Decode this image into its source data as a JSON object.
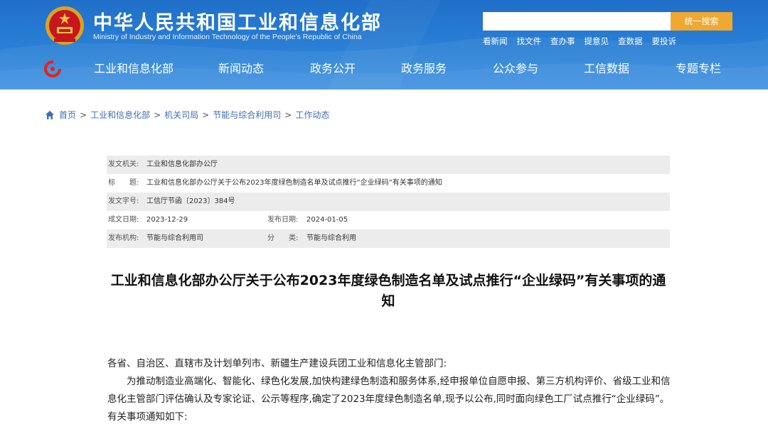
{
  "header": {
    "title": "中华人民共和国工业和信息化部",
    "subtitle": "Ministry of Industry and Information Technology of the People's Republic of China",
    "search_placeholder": "",
    "search_button": "统一搜索",
    "quick_links": [
      "看新闻",
      "找文件",
      "查办事",
      "提意见",
      "查数据",
      "要投诉"
    ],
    "colors": {
      "header_blue": "#2b80d6",
      "search_button": "#f0a830",
      "link_blue": "#3b6fb6"
    }
  },
  "nav": {
    "items": [
      "工业和信息化部",
      "新闻动态",
      "政务公开",
      "政务服务",
      "公众参与",
      "工信数据",
      "专题专栏"
    ]
  },
  "breadcrumb": {
    "items": [
      "首页",
      "工业和信息化部",
      "机关司局",
      "节能与综合利用司",
      "工作动态"
    ],
    "separator": ">"
  },
  "meta": {
    "issuer_label": "发文机关:",
    "issuer": "工业和信息化部办公厅",
    "title_label": "标　　题:",
    "title": "工业和信息化部办公厅关于公布2023年度绿色制造名单及试点推行“企业绿码”有关事项的通知",
    "doc_no_label": "发文字号:",
    "doc_no": "工信厅节函〔2023〕384号",
    "created_label": "成文日期:",
    "created": "2023-12-29",
    "published_label": "发布日期:",
    "published": "2024-01-05",
    "org_label": "发布机构:",
    "org": "节能与综合利用司",
    "category_label": "分　　类:",
    "category": "节能与综合利用"
  },
  "document": {
    "title": "工业和信息化部办公厅关于公布2023年度绿色制造名单及试点推行“企业绿码”有关事项的通知",
    "salutation": "各省、自治区、直辖市及计划单列市、新疆生产建设兵团工业和信息化主管部门:",
    "paragraph1": "为推动制造业高端化、智能化、绿色化发展,加快构建绿色制造和服务体系,经申报单位自愿申报、第三方机构评价、省级工业和信息化主管部门评估确认及专家论证、公示等程序,确定了2023年度绿色制造名单,现予以公布,同时面向绿色工厂试点推行“企业绿码”。有关事项通知如下:"
  }
}
